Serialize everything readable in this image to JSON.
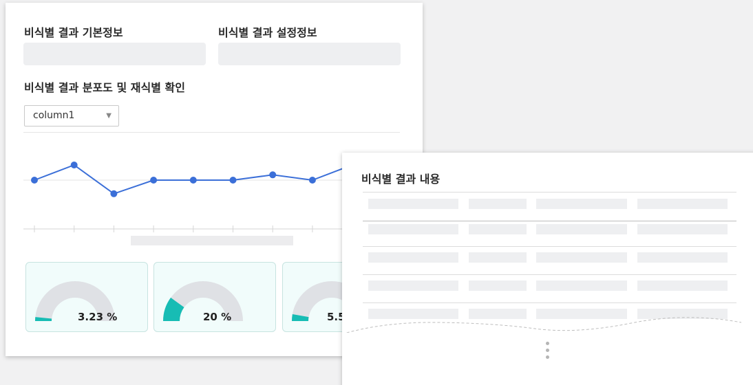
{
  "main_panel": {
    "basic_info_title": "비식별 결과 기본정보",
    "settings_info_title": "비식별 결과 설정정보",
    "distribution_title": "비식별 결과 분포도 및 재식별 확인",
    "column_select": {
      "value": "column1"
    }
  },
  "chart_data": {
    "type": "line",
    "x": [
      1,
      2,
      3,
      4,
      5,
      6,
      7,
      8,
      9
    ],
    "series": [
      {
        "values": [
          0,
          1,
          -0.9,
          0,
          0,
          0,
          0.35,
          0,
          1
        ]
      }
    ],
    "ylim": [
      -1.5,
      1.5
    ],
    "grid": true,
    "color": "#3b6fd8"
  },
  "gauges": [
    {
      "label": "3.23 %",
      "value": 3.23
    },
    {
      "label": "20 %",
      "value": 20
    },
    {
      "label": "5.5",
      "value": 5.5
    }
  ],
  "gauge_colors": {
    "fill": "#17bcb4",
    "track": "#dfe1e5"
  },
  "result_panel": {
    "title": "비식별 결과 내용"
  }
}
